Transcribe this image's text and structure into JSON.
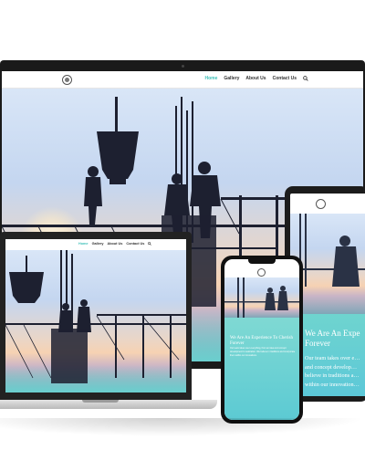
{
  "site": {
    "nav": {
      "items": [
        "Home",
        "Gallery",
        "About Us",
        "Contact Us"
      ],
      "active": "Home",
      "search_icon": "search-icon"
    },
    "hero": {
      "heading": "We Are An Experience To Cherish Forever",
      "body": "Our team takes over everything, from an idea and concept development to realization. We believe in traditions and incorporate them within our innovations."
    },
    "tablet": {
      "heading_visible": "We Are An Expe… Forever",
      "body_lines": [
        "Our team takes over e…",
        "and concept develop…",
        "believe in traditions a…",
        "within our innovation…"
      ]
    },
    "colors": {
      "accent": "#3fc1b9",
      "teal_panel": "#6fd4cf",
      "device_frame": "#1a1a1a"
    }
  }
}
